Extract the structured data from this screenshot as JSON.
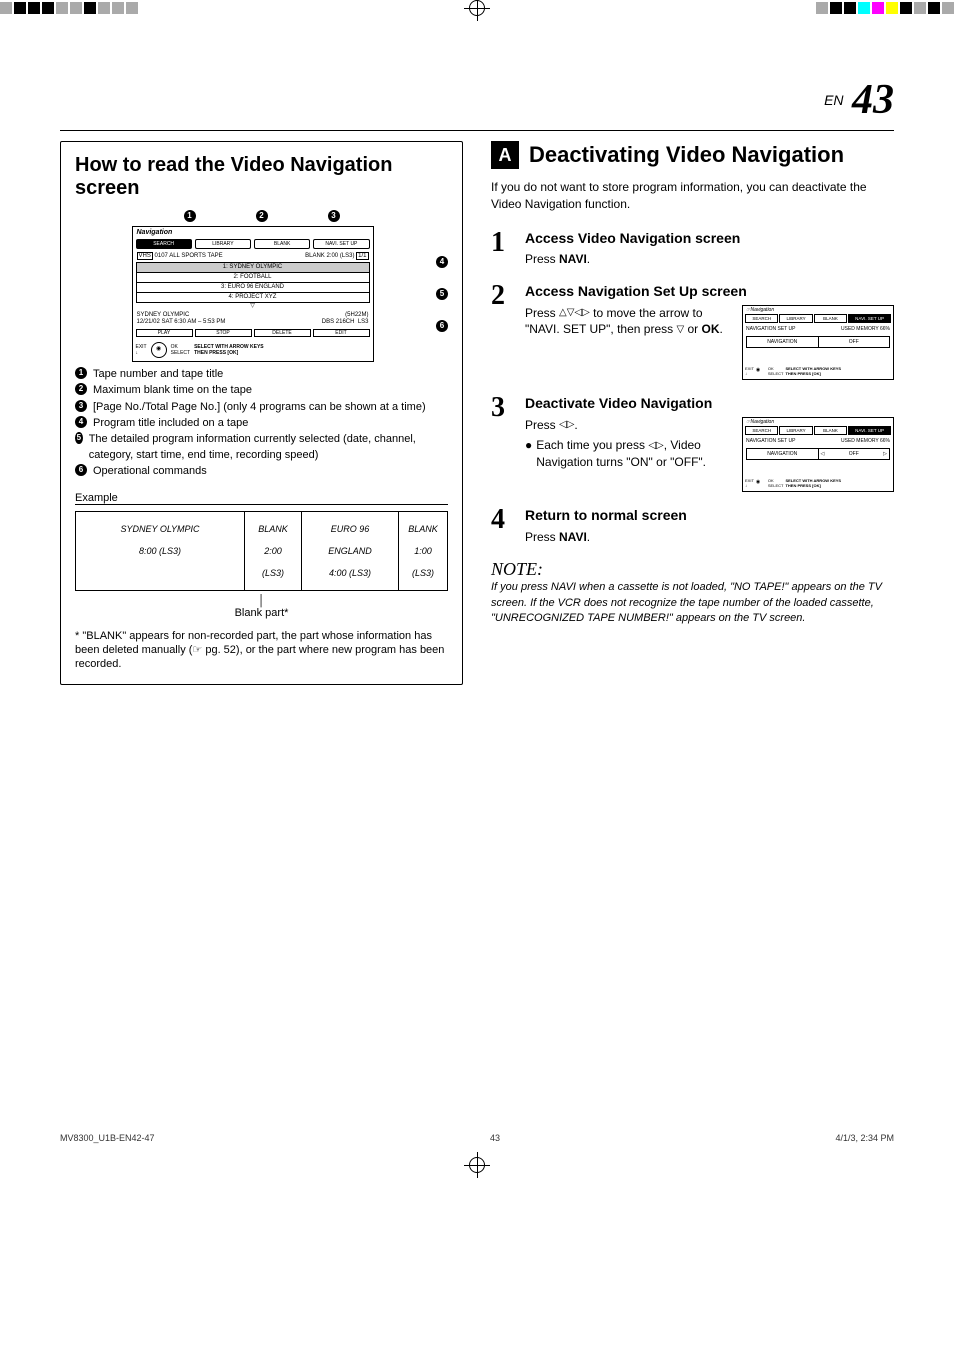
{
  "page": {
    "en": "EN",
    "num": "43"
  },
  "leftbox": {
    "title": "How to read the Video Navigation screen",
    "callouts": [
      "1",
      "2",
      "3",
      "4",
      "5",
      "6"
    ],
    "screen": {
      "brand": "Navigation",
      "tabs": [
        "SEARCH",
        "LIBRARY",
        "BLANK",
        "NAVI. SET UP"
      ],
      "tape_id": "0107",
      "tape_title": "ALL SPORTS TAPE",
      "blank_info": "BLANK 2:00 (LS3)",
      "pager": "1/1",
      "list": [
        "1: SYDNEY OLYMPIC",
        "2: FOOTBALL",
        "3: EURO 96 ENGLAND",
        "4: PROJECT XYZ"
      ],
      "detail_left_1": "SYDNEY OLYMPIC",
      "detail_left_2": "12/21/02 SAT  6:30 AM – 5:53 PM",
      "detail_right_1": "(5H22M)",
      "detail_right_2": "DBS 216CH",
      "detail_right_3": "LS3",
      "cmds": [
        "PLAY",
        "STOP",
        "DELETE",
        "EDIT"
      ],
      "footer_exit": "EXIT",
      "footer_ok": "OK",
      "footer_select": "SELECT",
      "footer_hint1": "SELECT WITH ARROW KEYS",
      "footer_hint2": "THEN PRESS [OK]"
    },
    "legend": {
      "l1": "Tape number and tape title",
      "l2": "Maximum blank time on the tape",
      "l3": "[Page No./Total Page No.] (only 4 programs can be shown at a time)",
      "l4": "Program title included on a tape",
      "l5": "The detailed program information currently selected (date, channel, category, start time, end time, recording speed)",
      "l6": "Operational commands"
    },
    "example_label": "Example",
    "tape": {
      "c1a": "SYDNEY OLYMPIC",
      "c1b": "8:00 (LS3)",
      "c2a": "BLANK",
      "c2b": "2:00",
      "c2c": "(LS3)",
      "c3a": "EURO 96",
      "c3b": "ENGLAND",
      "c3c": "4:00 (LS3)",
      "c4a": "BLANK",
      "c4b": "1:00",
      "c4c": "(LS3)"
    },
    "blank_part": "Blank part*",
    "footnote": "* \"BLANK\" appears for non-recorded part, the part whose information has been deleted manually (☞ pg. 52), or the part where new program has been recorded."
  },
  "right": {
    "badge": "A",
    "heading": "Deactivating Video Navigation",
    "intro": "If you do not want to store program information, you can deactivate the Video Navigation function.",
    "s1": {
      "title": "Access Video Navigation screen",
      "body_a": "Press ",
      "body_b": "NAVI",
      "body_c": "."
    },
    "s2": {
      "title": "Access Navigation Set Up screen",
      "body": "Press △▽◁▷ to move the arrow to \"NAVI. SET UP\", then press ▽ or OK.",
      "body_ok": "OK"
    },
    "s3": {
      "title": "Deactivate Video Navigation",
      "press": "Press ◁▷.",
      "bullet": "Each time you press ◁▷, Video Navigation turns \"ON\" or \"OFF\"."
    },
    "s4": {
      "title": "Return to normal screen",
      "body_a": "Press ",
      "body_b": "NAVI",
      "body_c": "."
    },
    "smallscreen": {
      "brand": "Navigation",
      "tabs": [
        "SEARCH",
        "LIBRARY",
        "BLANK",
        "NAVI. SET UP"
      ],
      "bar_left": "NAVIGATION SET UP",
      "bar_right": "USED MEMORY 66%",
      "row_label": "NAVIGATION",
      "row_value": "OFF",
      "footer_exit": "EXIT",
      "footer_ok": "OK",
      "footer_select": "SELECT",
      "footer_hint1": "SELECT WITH ARROW KEYS",
      "footer_hint2": "THEN PRESS [OK]"
    },
    "note_title": "NOTE:",
    "note_body": "If you press NAVI when a cassette is not loaded, \"NO TAPE!\" appears on the TV screen. If the VCR does not recognize the tape number of the loaded cassette, \"UNRECOGNIZED TAPE NUMBER!\" appears on the TV screen."
  },
  "jobfooter": {
    "left": "MV8300_U1B-EN42-47",
    "mid": "43",
    "right": "4/1/3, 2:34 PM"
  }
}
